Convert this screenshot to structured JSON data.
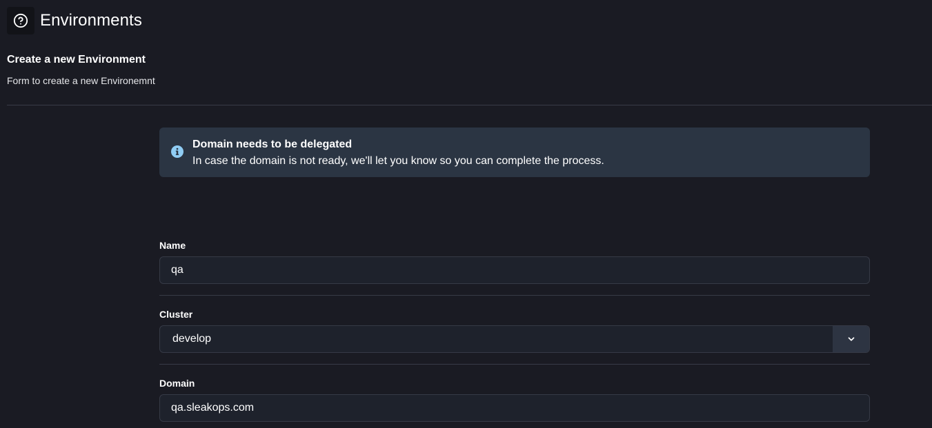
{
  "header": {
    "icon": "question-circle-icon",
    "title": "Environments"
  },
  "section": {
    "title": "Create a new Environment",
    "description": "Form to create a new Environemnt"
  },
  "alert": {
    "icon": "info-circle-icon",
    "title": "Domain needs to be delegated",
    "message": "In case the domain is not ready, we'll let you know so you can complete the process."
  },
  "form": {
    "name": {
      "label": "Name",
      "value": "qa"
    },
    "cluster": {
      "label": "Cluster",
      "selected": "develop",
      "toggle_icon": "chevron-down-icon"
    },
    "domain": {
      "label": "Domain",
      "value": "qa.sleakops.com"
    }
  },
  "colors": {
    "background": "#1a1b23",
    "alert_background": "#2b3543",
    "info_icon": "#90cdf4",
    "input_background": "#1e222c",
    "divider": "#383b47"
  }
}
